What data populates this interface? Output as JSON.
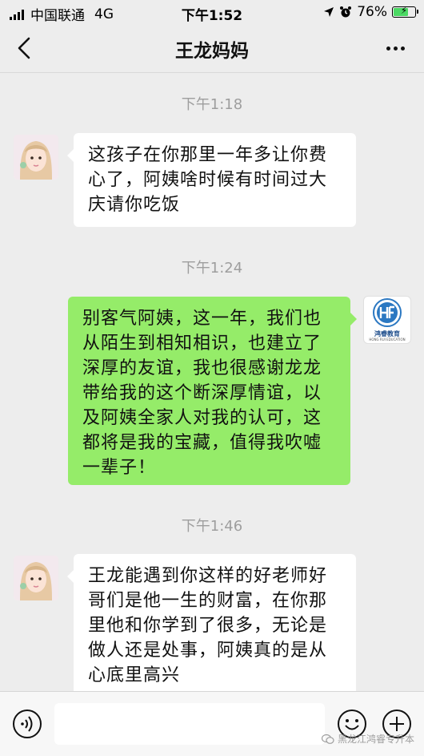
{
  "status_bar": {
    "carrier": "中国联通",
    "network": "4G",
    "time": "下午1:52",
    "battery": "76%",
    "battery_level": 0.76
  },
  "header": {
    "title": "王龙妈妈"
  },
  "messages": [
    {
      "time": "下午1:18",
      "sender": "other",
      "text": "这孩子在你那里一年多让你费心了，阿姨啥时候有时间过大庆请你吃饭"
    },
    {
      "time": "下午1:24",
      "sender": "me",
      "text": "别客气阿姨，这一年，我们也从陌生到相知相识，也建立了深厚的友谊，我也很感谢龙龙带给我的这个断深厚情谊，以及阿姨全家人对我的认可，这都将是我的宝藏，值得我吹嘘一辈子！"
    },
    {
      "time": "下午1:46",
      "sender": "other",
      "text": "王龙能遇到你这样的好老师好哥们是他一生的财富，在你那里他和你学到了很多，无论是做人还是处事，阿姨真的是从心底里高兴"
    }
  ],
  "my_avatar": {
    "brand": "鸿睿教育",
    "brand_en": "HONG RUI EDUCATION"
  },
  "input_bar": {
    "watermark": "黑龙江鸿睿专升本"
  }
}
